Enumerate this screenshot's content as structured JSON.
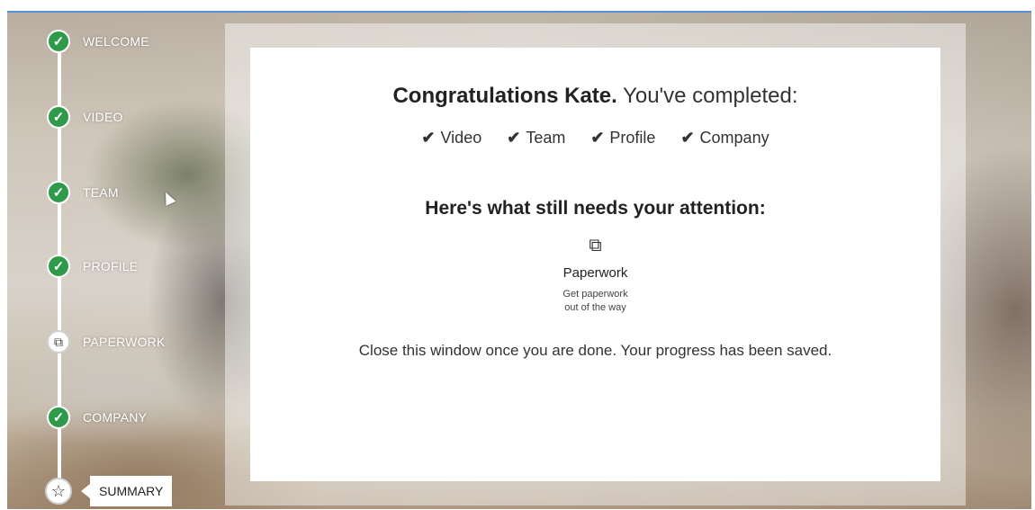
{
  "steps": [
    {
      "label": "WELCOME",
      "status": "done",
      "icon": "check-icon"
    },
    {
      "label": "VIDEO",
      "status": "done",
      "icon": "check-icon"
    },
    {
      "label": "TEAM",
      "status": "done",
      "icon": "check-icon"
    },
    {
      "label": "PROFILE",
      "status": "done",
      "icon": "check-icon"
    },
    {
      "label": "PAPERWORK",
      "status": "pending",
      "icon": "documents-icon"
    },
    {
      "label": "COMPANY",
      "status": "done",
      "icon": "check-icon"
    },
    {
      "label": "SUMMARY",
      "status": "current",
      "icon": "star-icon"
    }
  ],
  "panel": {
    "heading_bold": "Congratulations Kate.",
    "heading_rest": " You've completed:",
    "completed": [
      "Video",
      "Team",
      "Profile",
      "Company"
    ],
    "attention_title": "Here's what still needs your attention:",
    "task": {
      "icon": "documents-icon",
      "name": "Paperwork",
      "description_line1": "Get paperwork",
      "description_line2": "out of the way"
    },
    "footer": "Close this window once you are done. Your progress has been saved."
  },
  "colors": {
    "done_green": "#2e9a4a",
    "frame_border": "#5a8fd6"
  }
}
